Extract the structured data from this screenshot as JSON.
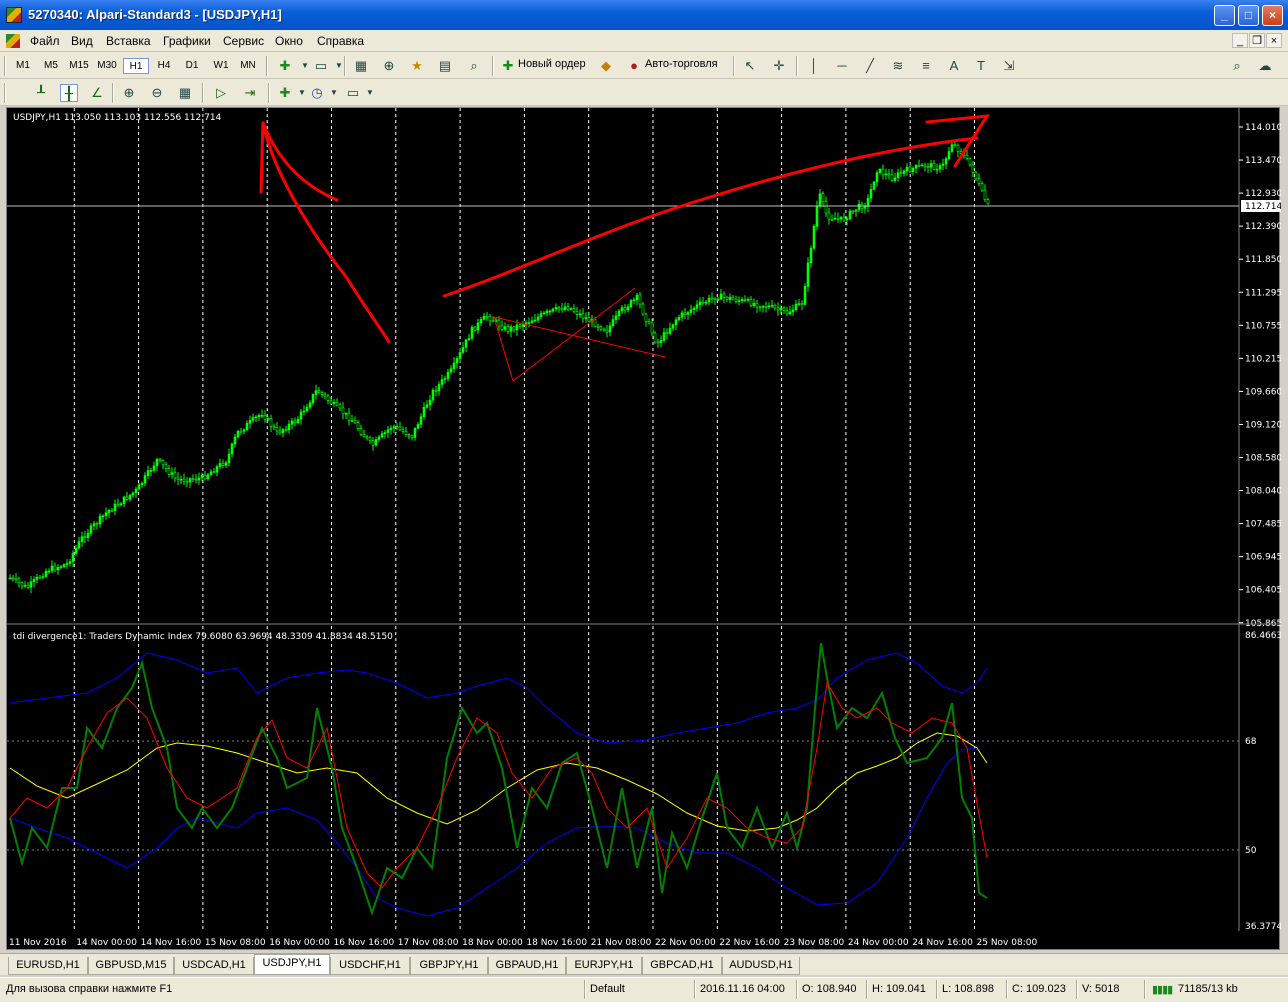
{
  "window": {
    "title": "5270340: Alpari-Standard3 - [USDJPY,H1]"
  },
  "menu": [
    "Файл",
    "Вид",
    "Вставка",
    "Графики",
    "Сервис",
    "Окно",
    "Справка"
  ],
  "toolbar": {
    "timeframes": [
      "M1",
      "M5",
      "M15",
      "M30",
      "H1",
      "H4",
      "D1",
      "W1",
      "MN"
    ],
    "active_timeframe": "H1",
    "new_order_label": "Новый ордер",
    "autotrading_label": "Авто-торговля"
  },
  "chart": {
    "header": "USDJPY,H1  113.050 113.103 112.556 112.714",
    "current_price": "112.714",
    "price_axis": [
      "114.010",
      "113.470",
      "112.930",
      "112.390",
      "111.850",
      "111.295",
      "110.755",
      "110.215",
      "109.660",
      "109.120",
      "108.580",
      "108.040",
      "107.485",
      "106.945",
      "106.405",
      "105.865"
    ],
    "indicator_header": "tdi divergence1: Traders Dynamic Index 79.6080 63.9694 48.3309 41.8834 48.5150",
    "indicator_axis": [
      "86.4663",
      "68",
      "50",
      "36.3774"
    ],
    "time_axis": [
      "11 Nov 2016",
      "14 Nov 00:00",
      "14 Nov 16:00",
      "15 Nov 08:00",
      "16 Nov 00:00",
      "16 Nov 16:00",
      "17 Nov 08:00",
      "18 Nov 00:00",
      "18 Nov 16:00",
      "21 Nov 08:00",
      "22 Nov 00:00",
      "22 Nov 16:00",
      "23 Nov 08:00",
      "24 Nov 00:00",
      "24 Nov 16:00",
      "25 Nov 08:00"
    ]
  },
  "tabs": [
    "EURUSD,H1",
    "GBPUSD,M15",
    "USDCAD,H1",
    "USDJPY,H1",
    "USDCHF,H1",
    "GBPJPY,H1",
    "GBPAUD,H1",
    "EURJPY,H1",
    "GBPCAD,H1",
    "AUDUSD,H1"
  ],
  "active_tab": "USDJPY,H1",
  "status": {
    "help": "Для вызова справки нажмите F1",
    "profile": "Default",
    "datetime": "2016.11.16 04:00",
    "open": "O: 108.940",
    "high": "H: 109.041",
    "low": "L: 108.898",
    "close": "C: 109.023",
    "volume": "V: 5018",
    "traffic": "71185/13 kb"
  },
  "colors": {
    "candles": "#00ff00",
    "tdi_rsi": "#008000",
    "tdi_signal": "#ff0000",
    "tdi_band": "#0000ff",
    "tdi_mid": "#ffff00",
    "annotation": "#ff0000"
  },
  "icons": [
    "app-icon",
    "new-chart-icon",
    "profiles-icon",
    "market-watch-icon",
    "navigator-icon",
    "crosshair-icon",
    "favorites-icon",
    "terminal-icon",
    "tester-icon",
    "new-order-icon",
    "meta-editor-icon",
    "autotrading-icon",
    "cursor-icon",
    "crosshair-tool-icon",
    "vertical-line-icon",
    "horizontal-line-icon",
    "trendline-icon",
    "fibo-icon",
    "text-icon",
    "label-icon",
    "arrows-icon",
    "bar-chart-icon",
    "candles-icon",
    "line-chart-icon",
    "zoom-in-icon",
    "zoom-out-icon",
    "tile-icon",
    "autoscroll-icon",
    "chart-shift-icon",
    "indicators-icon",
    "periods-icon",
    "templates-icon",
    "search-icon",
    "chat-icon"
  ]
}
